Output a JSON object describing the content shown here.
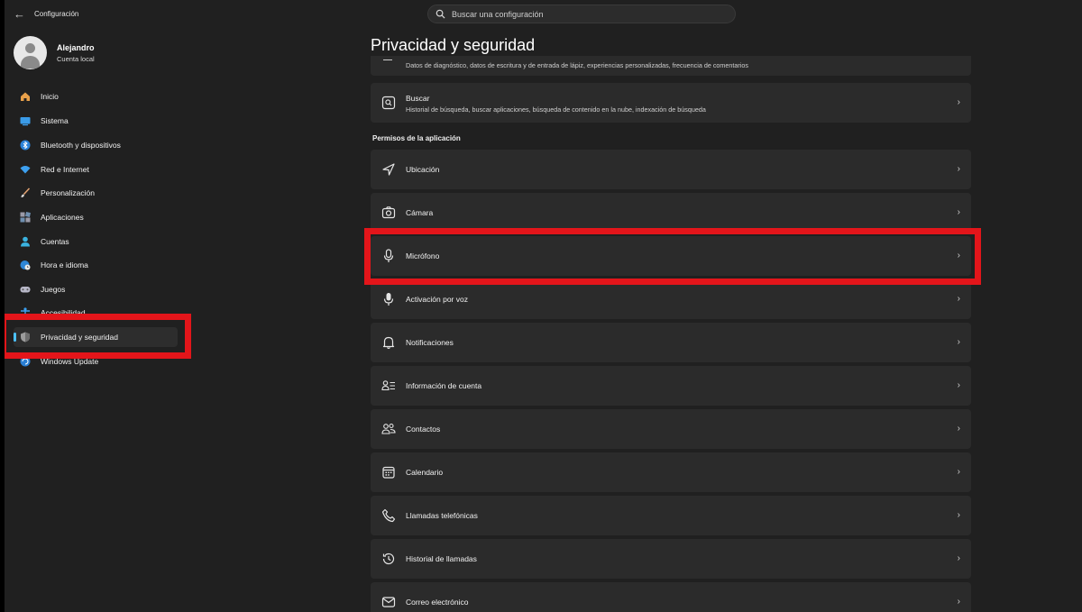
{
  "titlebar": {
    "back_icon": "back-arrow-icon",
    "app_title": "Configuración"
  },
  "search": {
    "placeholder": "Buscar una configuración",
    "icon": "search-icon"
  },
  "profile": {
    "name": "Alejandro",
    "account_type": "Cuenta local"
  },
  "sidebar": {
    "items": [
      {
        "label": "Inicio",
        "icon": "home-icon"
      },
      {
        "label": "Sistema",
        "icon": "system-icon"
      },
      {
        "label": "Bluetooth y dispositivos",
        "icon": "bluetooth-icon"
      },
      {
        "label": "Red e Internet",
        "icon": "wifi-icon"
      },
      {
        "label": "Personalización",
        "icon": "brush-icon"
      },
      {
        "label": "Aplicaciones",
        "icon": "apps-icon"
      },
      {
        "label": "Cuentas",
        "icon": "person-icon"
      },
      {
        "label": "Hora e idioma",
        "icon": "globe-clock-icon"
      },
      {
        "label": "Juegos",
        "icon": "gamepad-icon"
      },
      {
        "label": "Accesibilidad",
        "icon": "accessibility-icon"
      },
      {
        "label": "Privacidad y seguridad",
        "icon": "shield-icon",
        "selected": true
      },
      {
        "label": "Windows Update",
        "icon": "update-icon"
      }
    ]
  },
  "main": {
    "title": "Privacidad y seguridad",
    "top_cards": [
      {
        "subtitle": "Datos de diagnóstico, datos de escritura y de entrada de lápiz, experiencias personalizadas, frecuencia de comentarios"
      },
      {
        "title": "Buscar",
        "subtitle": "Historial de búsqueda, buscar aplicaciones, búsqueda de contenido en la nube, indexación de búsqueda",
        "icon": "search-box-icon"
      }
    ],
    "section_title": "Permisos de la aplicación",
    "permission_cards": [
      {
        "title": "Ubicación",
        "icon": "location-icon"
      },
      {
        "title": "Cámara",
        "icon": "camera-icon"
      },
      {
        "title": "Micrófono",
        "icon": "microphone-icon",
        "highlighted": true
      },
      {
        "title": "Activación por voz",
        "icon": "voice-activation-icon"
      },
      {
        "title": "Notificaciones",
        "icon": "bell-icon"
      },
      {
        "title": "Información de cuenta",
        "icon": "account-info-icon"
      },
      {
        "title": "Contactos",
        "icon": "contacts-icon"
      },
      {
        "title": "Calendario",
        "icon": "calendar-icon"
      },
      {
        "title": "Llamadas telefónicas",
        "icon": "phone-icon"
      },
      {
        "title": "Historial de llamadas",
        "icon": "history-icon"
      },
      {
        "title": "Correo electrónico",
        "icon": "mail-icon"
      }
    ]
  },
  "colors": {
    "highlight": "#e3151a",
    "accent": "#4cc2ff",
    "card": "#2b2b2b",
    "background": "#202020"
  }
}
